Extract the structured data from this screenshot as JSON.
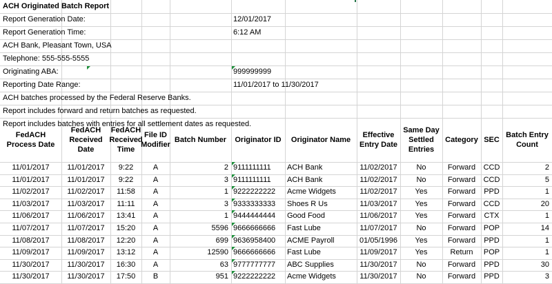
{
  "report": {
    "title": "ACH Originated Batch Report",
    "info": [
      {
        "label": "Report Generation Date:",
        "value": "12/01/2017"
      },
      {
        "label": "Report Generation Time:",
        "value": "6:12 AM"
      },
      {
        "label": "ACH Bank, Pleasant Town, USA",
        "value": ""
      },
      {
        "label": "Telephone: 555-555-5555",
        "value": ""
      },
      {
        "label": "Originating ABA:",
        "value": "999999999"
      },
      {
        "label": "Reporting Date Range:",
        "value": "11/01/2017 to 11/30/2017"
      },
      {
        "label": "ACH batches processed by the Federal Reserve Banks.",
        "value": ""
      },
      {
        "label": "Report includes forward and return batches as requested.",
        "value": ""
      },
      {
        "label": "Report includes batches with entries for all settlement dates as requested.",
        "value": ""
      }
    ]
  },
  "table": {
    "headers": [
      "FedACH Process Date",
      "FedACH Received Date",
      "FedACH Received Time",
      "File ID Modifier",
      "Batch Number",
      "Originator ID",
      "Originator Name",
      "Effective Entry Date",
      "Same Day Settled Entries",
      "Category",
      "SEC",
      "Batch Entry Count"
    ],
    "rows": [
      [
        "11/01/2017",
        "11/01/2017",
        "9:22",
        "A",
        "2",
        "9111111111",
        "ACH Bank",
        "11/02/2017",
        "No",
        "Forward",
        "CCD",
        "2"
      ],
      [
        "11/01/2017",
        "11/01/2017",
        "9:22",
        "A",
        "3",
        "9111111111",
        "ACH Bank",
        "11/02/2017",
        "No",
        "Forward",
        "CCD",
        "5"
      ],
      [
        "11/02/2017",
        "11/02/2017",
        "11:58",
        "A",
        "1",
        "9222222222",
        "Acme Widgets",
        "11/02/2017",
        "Yes",
        "Forward",
        "PPD",
        "1"
      ],
      [
        "11/03/2017",
        "11/03/2017",
        "11:11",
        "A",
        "3",
        "9333333333",
        "Shoes R Us",
        "11/03/2017",
        "Yes",
        "Forward",
        "CCD",
        "20"
      ],
      [
        "11/06/2017",
        "11/06/2017",
        "13:41",
        "A",
        "1",
        "9444444444",
        "Good Food",
        "11/06/2017",
        "Yes",
        "Forward",
        "CTX",
        "1"
      ],
      [
        "11/07/2017",
        "11/07/2017",
        "15:20",
        "A",
        "5596",
        "9666666666",
        "Fast Lube",
        "11/07/2017",
        "No",
        "Forward",
        "POP",
        "14"
      ],
      [
        "11/08/2017",
        "11/08/2017",
        "12:20",
        "A",
        "699",
        "9636958400",
        "ACME Payroll",
        "01/05/1996",
        "Yes",
        "Forward",
        "PPD",
        "1"
      ],
      [
        "11/09/2017",
        "11/09/2017",
        "13:12",
        "A",
        "12590",
        "9666666666",
        "Fast Lube",
        "11/09/2017",
        "Yes",
        "Return",
        "POP",
        "1"
      ],
      [
        "11/30/2017",
        "11/30/2017",
        "16:30",
        "A",
        "63",
        "9777777777",
        "ABC Supplies",
        "11/30/2017",
        "No",
        "Forward",
        "PPD",
        "30"
      ],
      [
        "11/30/2017",
        "11/30/2017",
        "17:50",
        "B",
        "951",
        "9222222222",
        "Acme Widgets",
        "11/30/2017",
        "No",
        "Forward",
        "PPD",
        "3"
      ]
    ]
  }
}
